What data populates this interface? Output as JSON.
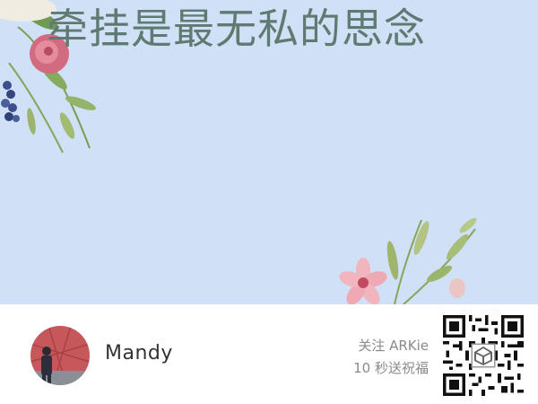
{
  "poster": {
    "headline": "牵挂是最无私的思念",
    "background_color": "#cfe0f7",
    "headline_color": "#5f7a70"
  },
  "footer": {
    "username": "Mandy",
    "promo_line1": "关注 ARKie",
    "promo_line2": "10 秒送祝福",
    "avatar_icon": "profile-photo",
    "qr_icon": "qr-code-icon"
  }
}
